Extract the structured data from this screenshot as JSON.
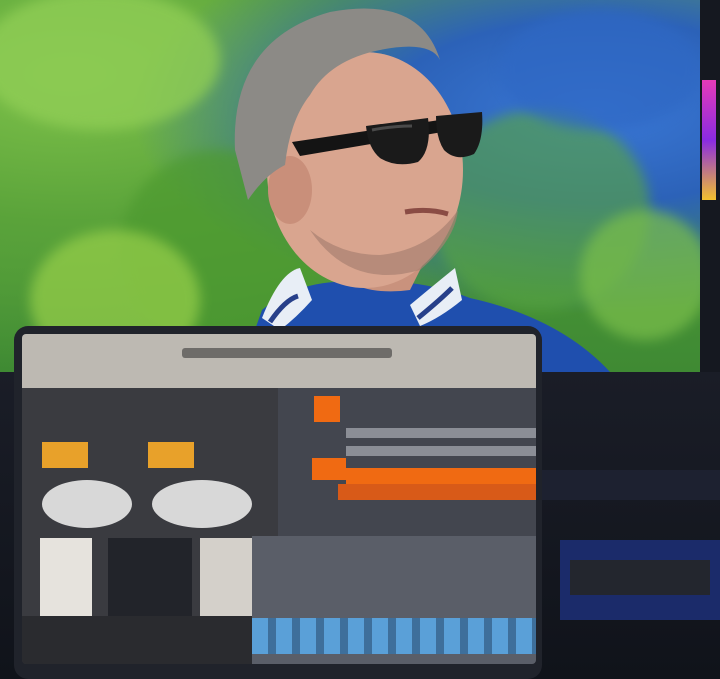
{
  "scene": {
    "description_free": true
  },
  "colors": {
    "foliage": "#5aa33a",
    "sky": "#3a78d6",
    "jacket": "#1f4fae",
    "vu_meter": "#e8a12a",
    "region_orange": "#f06a12",
    "fader_blue": "#5aa0d8",
    "reel_light": "#d8d8d8"
  },
  "icons": [
    "sunglasses-icon"
  ]
}
